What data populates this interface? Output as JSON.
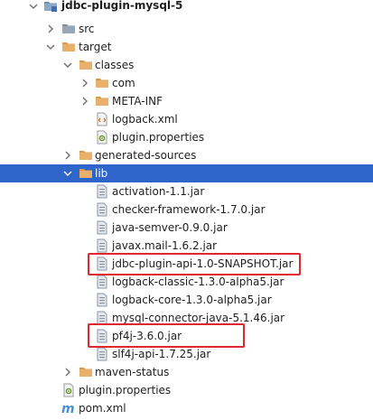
{
  "tree": {
    "project": "jdbc-plugin-mysql-5",
    "src": "src",
    "target": "target",
    "classes": "classes",
    "com": "com",
    "meta_inf": "META-INF",
    "logback_xml": "logback.xml",
    "classes_plugin_properties": "plugin.properties",
    "generated_sources": "generated-sources",
    "lib": "lib",
    "jars": [
      "activation-1.1.jar",
      "checker-framework-1.7.0.jar",
      "java-semver-0.9.0.jar",
      "javax.mail-1.6.2.jar",
      "jdbc-plugin-api-1.0-SNAPSHOT.jar",
      "logback-classic-1.3.0-alpha5.jar",
      "logback-core-1.3.0-alpha5.jar",
      "mysql-connector-java-5.1.46.jar",
      "pf4j-3.6.0.jar",
      "slf4j-api-1.7.25.jar"
    ],
    "maven_status": "maven-status",
    "plugin_properties": "plugin.properties",
    "pom_xml": "pom.xml"
  },
  "colors": {
    "selection": "#2f65ca",
    "highlight_box": "#e0262f",
    "folder": "#d99a4a",
    "source_folder": "#7d8ea0",
    "maven": "#4b8fd6"
  },
  "icons": {
    "folder": "folder-icon",
    "module": "module-folder-icon",
    "jar": "jar-file-icon",
    "xml": "xml-file-icon",
    "properties": "properties-file-icon",
    "maven": "maven-pom-icon"
  }
}
